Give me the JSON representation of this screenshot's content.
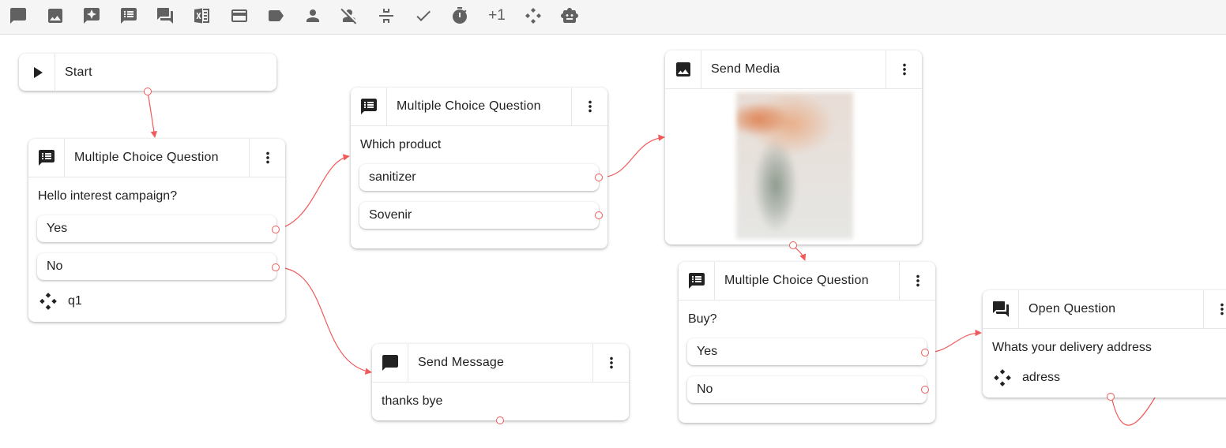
{
  "toolbar": {
    "items": [
      {
        "icon": "message-icon"
      },
      {
        "icon": "image-icon"
      },
      {
        "icon": "sparkle-message-icon"
      },
      {
        "icon": "list-message-icon"
      },
      {
        "icon": "chat-question-icon"
      },
      {
        "icon": "excel-icon"
      },
      {
        "icon": "credit-card-icon"
      },
      {
        "icon": "label-icon"
      },
      {
        "icon": "person-icon"
      },
      {
        "icon": "person-off-icon"
      },
      {
        "icon": "split-icon"
      },
      {
        "icon": "check-icon"
      },
      {
        "icon": "timer-icon"
      },
      {
        "icon": "plus-one-icon",
        "label": "+1"
      },
      {
        "icon": "variable-icon"
      },
      {
        "icon": "robot-icon"
      }
    ]
  },
  "accent_color": "#f05a5a",
  "nodes": {
    "start": {
      "title": "Start",
      "icon": "play-icon"
    },
    "mcq1": {
      "title": "Multiple Choice Question",
      "question": "Hello interest campaign?",
      "options": [
        "Yes",
        "No"
      ],
      "variable": "q1"
    },
    "mcq2": {
      "title": "Multiple Choice Question",
      "question": "Which product",
      "options": [
        "sanitizer",
        "Sovenir"
      ]
    },
    "media": {
      "title": "Send Media"
    },
    "message": {
      "title": "Send Message",
      "text": "thanks bye"
    },
    "mcq3": {
      "title": "Multiple Choice Question",
      "question": "Buy?",
      "options": [
        "Yes",
        "No"
      ]
    },
    "open": {
      "title": "Open Question",
      "question": "Whats your delivery address",
      "variable": "adress"
    }
  }
}
